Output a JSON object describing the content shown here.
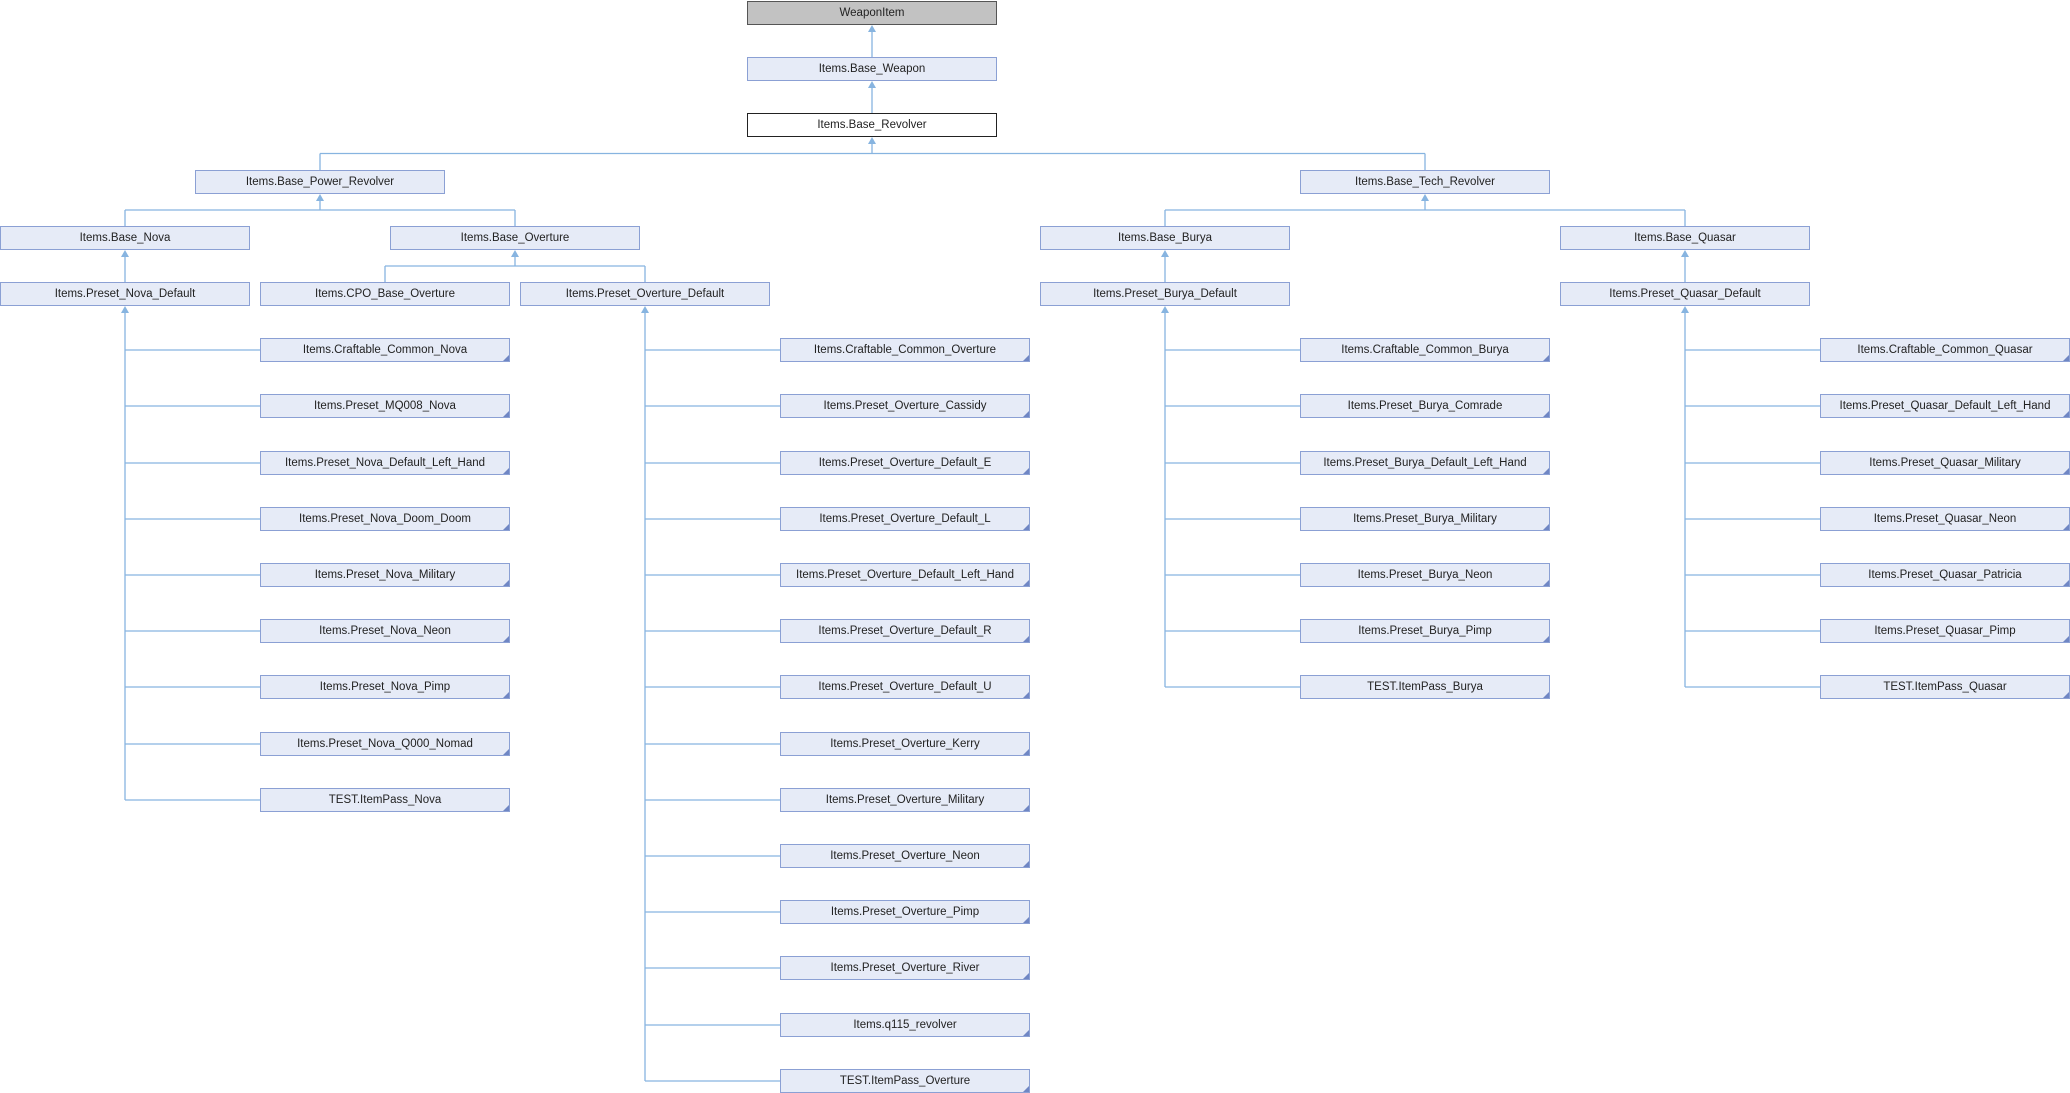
{
  "diagram": {
    "nodes": [
      {
        "id": "weaponitem",
        "label": "WeaponItem",
        "style": "root"
      },
      {
        "id": "base_weapon",
        "label": "Items.Base_Weapon"
      },
      {
        "id": "base_revolver",
        "label": "Items.Base_Revolver",
        "style": "focus"
      },
      {
        "id": "base_power_revolver",
        "label": "Items.Base_Power_Revolver"
      },
      {
        "id": "base_tech_revolver",
        "label": "Items.Base_Tech_Revolver"
      },
      {
        "id": "base_nova",
        "label": "Items.Base_Nova"
      },
      {
        "id": "base_overture",
        "label": "Items.Base_Overture"
      },
      {
        "id": "base_burya",
        "label": "Items.Base_Burya"
      },
      {
        "id": "base_quasar",
        "label": "Items.Base_Quasar"
      },
      {
        "id": "preset_nova_default",
        "label": "Items.Preset_Nova_Default"
      },
      {
        "id": "cpo_base_overture",
        "label": "Items.CPO_Base_Overture"
      },
      {
        "id": "preset_overture_default",
        "label": "Items.Preset_Overture_Default"
      },
      {
        "id": "preset_burya_default",
        "label": "Items.Preset_Burya_Default"
      },
      {
        "id": "preset_quasar_default",
        "label": "Items.Preset_Quasar_Default"
      },
      {
        "id": "n1",
        "label": "Items.Craftable_Common_Nova",
        "trunc": true
      },
      {
        "id": "n2",
        "label": "Items.Preset_MQ008_Nova",
        "trunc": true
      },
      {
        "id": "n3",
        "label": "Items.Preset_Nova_Default_Left_Hand",
        "trunc": true
      },
      {
        "id": "n4",
        "label": "Items.Preset_Nova_Doom_Doom",
        "trunc": true
      },
      {
        "id": "n5",
        "label": "Items.Preset_Nova_Military",
        "trunc": true
      },
      {
        "id": "n6",
        "label": "Items.Preset_Nova_Neon",
        "trunc": true
      },
      {
        "id": "n7",
        "label": "Items.Preset_Nova_Pimp",
        "trunc": true
      },
      {
        "id": "n8",
        "label": "Items.Preset_Nova_Q000_Nomad",
        "trunc": true
      },
      {
        "id": "n9",
        "label": "TEST.ItemPass_Nova",
        "trunc": true
      },
      {
        "id": "o1",
        "label": "Items.Craftable_Common_Overture",
        "trunc": true
      },
      {
        "id": "o2",
        "label": "Items.Preset_Overture_Cassidy",
        "trunc": true
      },
      {
        "id": "o3",
        "label": "Items.Preset_Overture_Default_E",
        "trunc": true
      },
      {
        "id": "o4",
        "label": "Items.Preset_Overture_Default_L",
        "trunc": true
      },
      {
        "id": "o5",
        "label": "Items.Preset_Overture_Default_Left_Hand",
        "trunc": true
      },
      {
        "id": "o6",
        "label": "Items.Preset_Overture_Default_R",
        "trunc": true
      },
      {
        "id": "o7",
        "label": "Items.Preset_Overture_Default_U",
        "trunc": true
      },
      {
        "id": "o8",
        "label": "Items.Preset_Overture_Kerry",
        "trunc": true
      },
      {
        "id": "o9",
        "label": "Items.Preset_Overture_Military",
        "trunc": true
      },
      {
        "id": "o10",
        "label": "Items.Preset_Overture_Neon",
        "trunc": true
      },
      {
        "id": "o11",
        "label": "Items.Preset_Overture_Pimp",
        "trunc": true
      },
      {
        "id": "o12",
        "label": "Items.Preset_Overture_River",
        "trunc": true
      },
      {
        "id": "o13",
        "label": "Items.q115_revolver",
        "trunc": true
      },
      {
        "id": "o14",
        "label": "TEST.ItemPass_Overture",
        "trunc": true
      },
      {
        "id": "b1",
        "label": "Items.Craftable_Common_Burya",
        "trunc": true
      },
      {
        "id": "b2",
        "label": "Items.Preset_Burya_Comrade",
        "trunc": true
      },
      {
        "id": "b3",
        "label": "Items.Preset_Burya_Default_Left_Hand",
        "trunc": true
      },
      {
        "id": "b4",
        "label": "Items.Preset_Burya_Military",
        "trunc": true
      },
      {
        "id": "b5",
        "label": "Items.Preset_Burya_Neon",
        "trunc": true
      },
      {
        "id": "b6",
        "label": "Items.Preset_Burya_Pimp",
        "trunc": true
      },
      {
        "id": "b7",
        "label": "TEST.ItemPass_Burya",
        "trunc": true
      },
      {
        "id": "q1",
        "label": "Items.Craftable_Common_Quasar",
        "trunc": true
      },
      {
        "id": "q2",
        "label": "Items.Preset_Quasar_Default_Left_Hand",
        "trunc": true
      },
      {
        "id": "q3",
        "label": "Items.Preset_Quasar_Military",
        "trunc": true
      },
      {
        "id": "q4",
        "label": "Items.Preset_Quasar_Neon",
        "trunc": true
      },
      {
        "id": "q5",
        "label": "Items.Preset_Quasar_Patricia",
        "trunc": true
      },
      {
        "id": "q6",
        "label": "Items.Preset_Quasar_Pimp",
        "trunc": true
      },
      {
        "id": "q7",
        "label": "TEST.ItemPass_Quasar",
        "trunc": true
      }
    ],
    "edges": [
      [
        "base_weapon",
        "weaponitem"
      ],
      [
        "base_revolver",
        "base_weapon"
      ],
      [
        "base_power_revolver",
        "base_revolver"
      ],
      [
        "base_tech_revolver",
        "base_revolver"
      ],
      [
        "base_nova",
        "base_power_revolver"
      ],
      [
        "base_overture",
        "base_power_revolver"
      ],
      [
        "base_burya",
        "base_tech_revolver"
      ],
      [
        "base_quasar",
        "base_tech_revolver"
      ],
      [
        "preset_nova_default",
        "base_nova"
      ],
      [
        "cpo_base_overture",
        "base_overture"
      ],
      [
        "preset_overture_default",
        "base_overture"
      ],
      [
        "preset_burya_default",
        "base_burya"
      ],
      [
        "preset_quasar_default",
        "base_quasar"
      ],
      [
        "n1",
        "preset_nova_default"
      ],
      [
        "n2",
        "preset_nova_default"
      ],
      [
        "n3",
        "preset_nova_default"
      ],
      [
        "n4",
        "preset_nova_default"
      ],
      [
        "n5",
        "preset_nova_default"
      ],
      [
        "n6",
        "preset_nova_default"
      ],
      [
        "n7",
        "preset_nova_default"
      ],
      [
        "n8",
        "preset_nova_default"
      ],
      [
        "n9",
        "preset_nova_default"
      ],
      [
        "o1",
        "preset_overture_default"
      ],
      [
        "o2",
        "preset_overture_default"
      ],
      [
        "o3",
        "preset_overture_default"
      ],
      [
        "o4",
        "preset_overture_default"
      ],
      [
        "o5",
        "preset_overture_default"
      ],
      [
        "o6",
        "preset_overture_default"
      ],
      [
        "o7",
        "preset_overture_default"
      ],
      [
        "o8",
        "preset_overture_default"
      ],
      [
        "o9",
        "preset_overture_default"
      ],
      [
        "o10",
        "preset_overture_default"
      ],
      [
        "o11",
        "preset_overture_default"
      ],
      [
        "o12",
        "preset_overture_default"
      ],
      [
        "o13",
        "preset_overture_default"
      ],
      [
        "o14",
        "preset_overture_default"
      ],
      [
        "b1",
        "preset_burya_default"
      ],
      [
        "b2",
        "preset_burya_default"
      ],
      [
        "b3",
        "preset_burya_default"
      ],
      [
        "b4",
        "preset_burya_default"
      ],
      [
        "b5",
        "preset_burya_default"
      ],
      [
        "b6",
        "preset_burya_default"
      ],
      [
        "b7",
        "preset_burya_default"
      ],
      [
        "q1",
        "preset_quasar_default"
      ],
      [
        "q2",
        "preset_quasar_default"
      ],
      [
        "q3",
        "preset_quasar_default"
      ],
      [
        "q4",
        "preset_quasar_default"
      ],
      [
        "q5",
        "preset_quasar_default"
      ],
      [
        "q6",
        "preset_quasar_default"
      ],
      [
        "q7",
        "preset_quasar_default"
      ]
    ]
  }
}
